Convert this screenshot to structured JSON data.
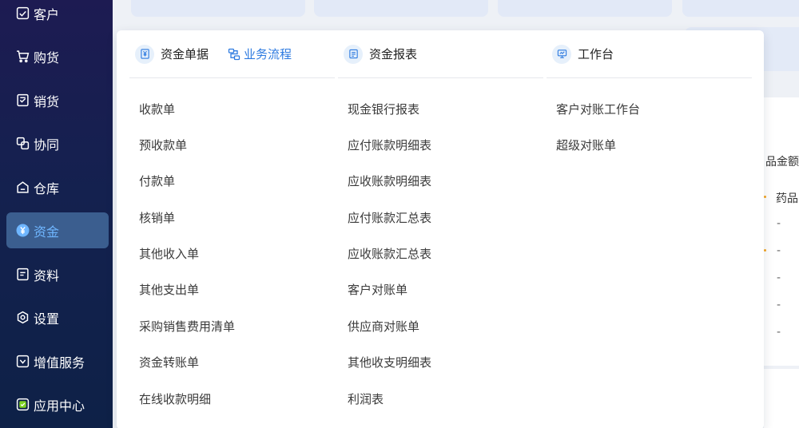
{
  "sidebar": {
    "items": [
      {
        "label": "客户",
        "icon": "customer-icon"
      },
      {
        "label": "购货",
        "icon": "cart-icon"
      },
      {
        "label": "销货",
        "icon": "sales-doc-icon"
      },
      {
        "label": "协同",
        "icon": "collab-icon"
      },
      {
        "label": "仓库",
        "icon": "warehouse-icon"
      },
      {
        "label": "资金",
        "icon": "yen-coin-icon",
        "active": true
      },
      {
        "label": "资料",
        "icon": "document-icon"
      },
      {
        "label": "设置",
        "icon": "settings-icon"
      },
      {
        "label": "增值服务",
        "icon": "value-service-icon"
      },
      {
        "label": "应用中心",
        "icon": "app-center-icon"
      }
    ]
  },
  "menu": {
    "columns": [
      {
        "title": "资金单据",
        "icon": "receipt-icon",
        "link": "业务流程",
        "items": [
          "收款单",
          "预收款单",
          "付款单",
          "核销单",
          "其他收入单",
          "其他支出单",
          "采购销售费用清单",
          "资金转账单",
          "在线收款明细"
        ]
      },
      {
        "title": "资金报表",
        "icon": "report-icon",
        "items": [
          "现金银行报表",
          "应付账款明细表",
          "应收账款明细表",
          "应付账款汇总表",
          "应收账款汇总表",
          "客户对账单",
          "供应商对账单",
          "其他收支明细表",
          "利润表"
        ]
      },
      {
        "title": "工作台",
        "icon": "workbench-icon",
        "items": [
          "客户对账工作台",
          "超级对账单"
        ]
      }
    ]
  },
  "right_panel": {
    "header": "品金额",
    "first_row": "药品",
    "placeholders": [
      "-",
      "-",
      "-",
      "-",
      "-"
    ]
  },
  "colors": {
    "accent": "#2d7ae0",
    "sidebar_bg": "#1d1b52",
    "active_item_bg": "#3b5e8f",
    "active_item_text": "#6fb6ff"
  }
}
